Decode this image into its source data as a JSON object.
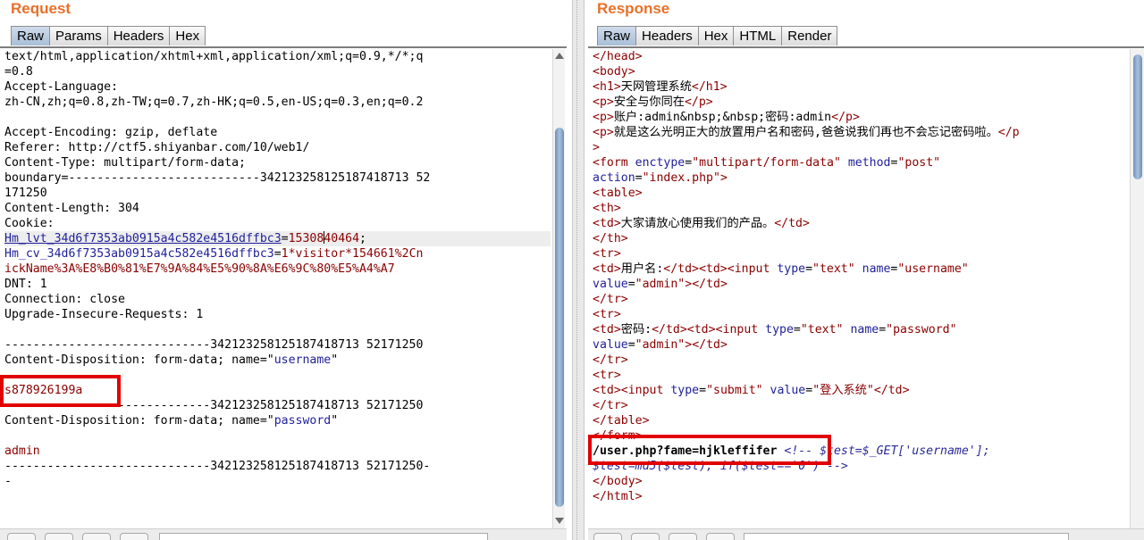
{
  "request": {
    "title": "Request",
    "tabs": [
      "Raw",
      "Params",
      "Headers",
      "Hex"
    ],
    "active_tab": "Raw",
    "lines": {
      "accept1": "text/html,application/xhtml+xml,application/xml;q=0.9,*/*;q",
      "accept2": "=0.8",
      "lang_label": "Accept-Language:",
      "lang_value": "zh-CN,zh;q=0.8,zh-TW;q=0.7,zh-HK;q=0.5,en-US;q=0.3,en;q=0.2",
      "encoding": "Accept-Encoding: gzip, deflate",
      "referer": "Referer: http://ctf5.shiyanbar.com/10/web1/",
      "content_type": "Content-Type: multipart/form-data;",
      "boundary1": "boundary=---------------------------342123258125187418713 52",
      "boundary2": "171250",
      "content_length": "Content-Length: 304",
      "cookie": "Cookie:",
      "hm_lvt_name": "Hm_lvt_34d6f7353ab0915a4c582e4516dffbc3",
      "hm_lvt_eq": "=",
      "hm_lvt_val_a": "15308",
      "hm_lvt_val_b": "40464",
      "hm_lvt_end": ";",
      "hm_cv_name": "Hm_cv_34d6f7353ab0915a4c582e4516dffbc3",
      "hm_cv_eq": "=",
      "hm_cv_val": "1*visitor*154661%2Cn",
      "hm_cv_val2": "ickName%3A%E8%B0%81%E7%9A%84%E5%90%8A%E6%9C%80%E5%A4%A7",
      "dnt": "DNT: 1",
      "connection": "Connection: close",
      "upgrade": "Upgrade-Insecure-Requests: 1",
      "sep1": "-----------------------------342123258125187418713 52171250",
      "cd1_prefix": "Content-Disposition: form-data; name=\"",
      "cd1_name": "username",
      "cd1_suffix": "\"",
      "username_value": "s878926199a",
      "sep2": "-----------------------------342123258125187418713 52171250",
      "cd2_prefix": "Content-Disposition: form-data; name=\"",
      "cd2_name": "password",
      "cd2_suffix": "\"",
      "password_value": "admin",
      "sep3": "-----------------------------342123258125187418713 52171250-",
      "sep3b": "-"
    }
  },
  "response": {
    "title": "Response",
    "tabs": [
      "Raw",
      "Headers",
      "Hex",
      "HTML",
      "Render"
    ],
    "active_tab": "Raw",
    "lines": {
      "head_close": "</head>",
      "body_open": "<body>",
      "h1_open": "<h1>",
      "h1_text": "天网管理系统",
      "h1_close": "</h1>",
      "p1_open": "<p>",
      "p1_text": "安全与你同在",
      "p1_close": "</p>",
      "p2_open": "<p>",
      "p2_text": "账户:admin&nbsp;&nbsp;密码:admin",
      "p2_close": "</p>",
      "p3_open": "<p>",
      "p3_text": "就是这么光明正大的放置用户名和密码,爸爸说我们再也不会忘记密码啦。",
      "p3_close_a": "</p",
      "p3_close_b": ">",
      "form_open": "<form",
      "form_attr1": " enctype",
      "form_eq1": "=",
      "form_val1": "\"multipart/form-data\"",
      "form_attr2": " method",
      "form_eq2": "=",
      "form_val2": "\"post\"",
      "form_attr3": "action",
      "form_eq3": "=",
      "form_val3": "\"index.php\"",
      "form_gt": ">",
      "table_open": "<table>",
      "th_open": "<th>",
      "td_open": "<td>",
      "th_text": "大家请放心使用我们的产品。",
      "td_close": "</td>",
      "th_close": "</th>",
      "tr_open": "<tr>",
      "tr_close": "</tr>",
      "username_label": "用户名:",
      "password_label": "密码:",
      "input_open": "<input",
      "type_attr": " type",
      "type_text": "\"text\"",
      "type_submit": "\"submit\"",
      "name_attr": " name",
      "name_username": "\"username\"",
      "name_password": "\"password\"",
      "value_attr": "value",
      "value_attr_sp": " value",
      "value_admin": "\"admin\"",
      "value_login": "\"登入系统\"",
      "eq": "=",
      "gt": ">",
      "table_close": "</table>",
      "form_close": "</form>",
      "user_php": "/user.php?fame=hjkleffifer",
      "comment1": " <!-- $test=$_GET['username'];",
      "comment2": "$test=md5($test); if($test=='0') -->",
      "body_close": "</body>",
      "html_close": "</html>"
    }
  },
  "colors": {
    "title": "#e8702a",
    "tag": "#8b0000",
    "attr": "#1f1f9b",
    "highlight_box": "#e10000"
  }
}
